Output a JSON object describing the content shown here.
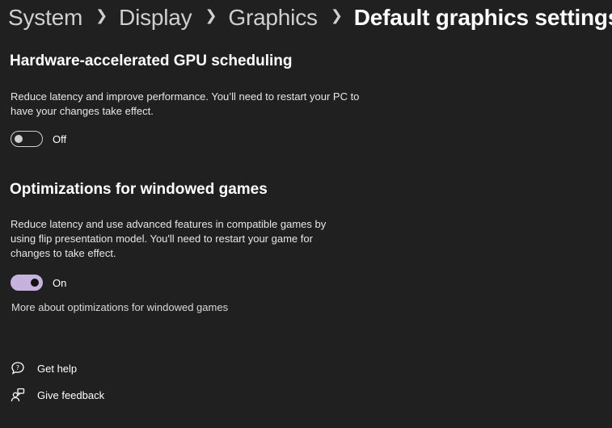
{
  "breadcrumb": {
    "items": [
      "System",
      "Display",
      "Graphics"
    ],
    "current": "Default graphics settings",
    "separator_icon": "chevron-right-icon"
  },
  "gpu_scheduling": {
    "title": "Hardware-accelerated GPU scheduling",
    "description": "Reduce latency and improve performance. You’ll need to restart your PC to have your changes take effect.",
    "toggle_state": "Off",
    "enabled": false
  },
  "windowed_games": {
    "title": "Optimizations for windowed games",
    "description": "Reduce latency and use advanced features in compatible games by using flip presentation model. You'll need to restart your game for changes to take effect.",
    "toggle_state": "On",
    "enabled": true,
    "link": "More about optimizations for windowed games"
  },
  "footer": {
    "get_help": "Get help",
    "give_feedback": "Give feedback",
    "get_help_icon": "help-chat-icon",
    "give_feedback_icon": "feedback-person-icon"
  },
  "colors": {
    "background": "#202020",
    "accent": "#c5b3de",
    "text": "#ffffff"
  }
}
